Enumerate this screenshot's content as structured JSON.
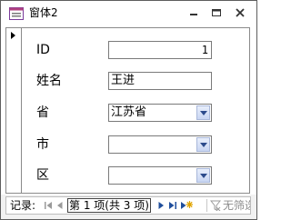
{
  "window": {
    "title": "窗体2"
  },
  "form": {
    "fields": [
      {
        "label": "ID",
        "value": "1"
      },
      {
        "label": "姓名",
        "value": "王进"
      },
      {
        "label": "省",
        "value": "江苏省"
      },
      {
        "label": "市",
        "value": ""
      },
      {
        "label": "区",
        "value": ""
      }
    ]
  },
  "navigation": {
    "label": "记录:",
    "record_text": "第 1 项(共 3 项)",
    "filter_text": "无筛选",
    "current_record": 1,
    "total_records": 3
  },
  "colors": {
    "accent": "#1f4e9c",
    "dropdown": "#c9d6f3",
    "border": "#7a7a7a"
  }
}
